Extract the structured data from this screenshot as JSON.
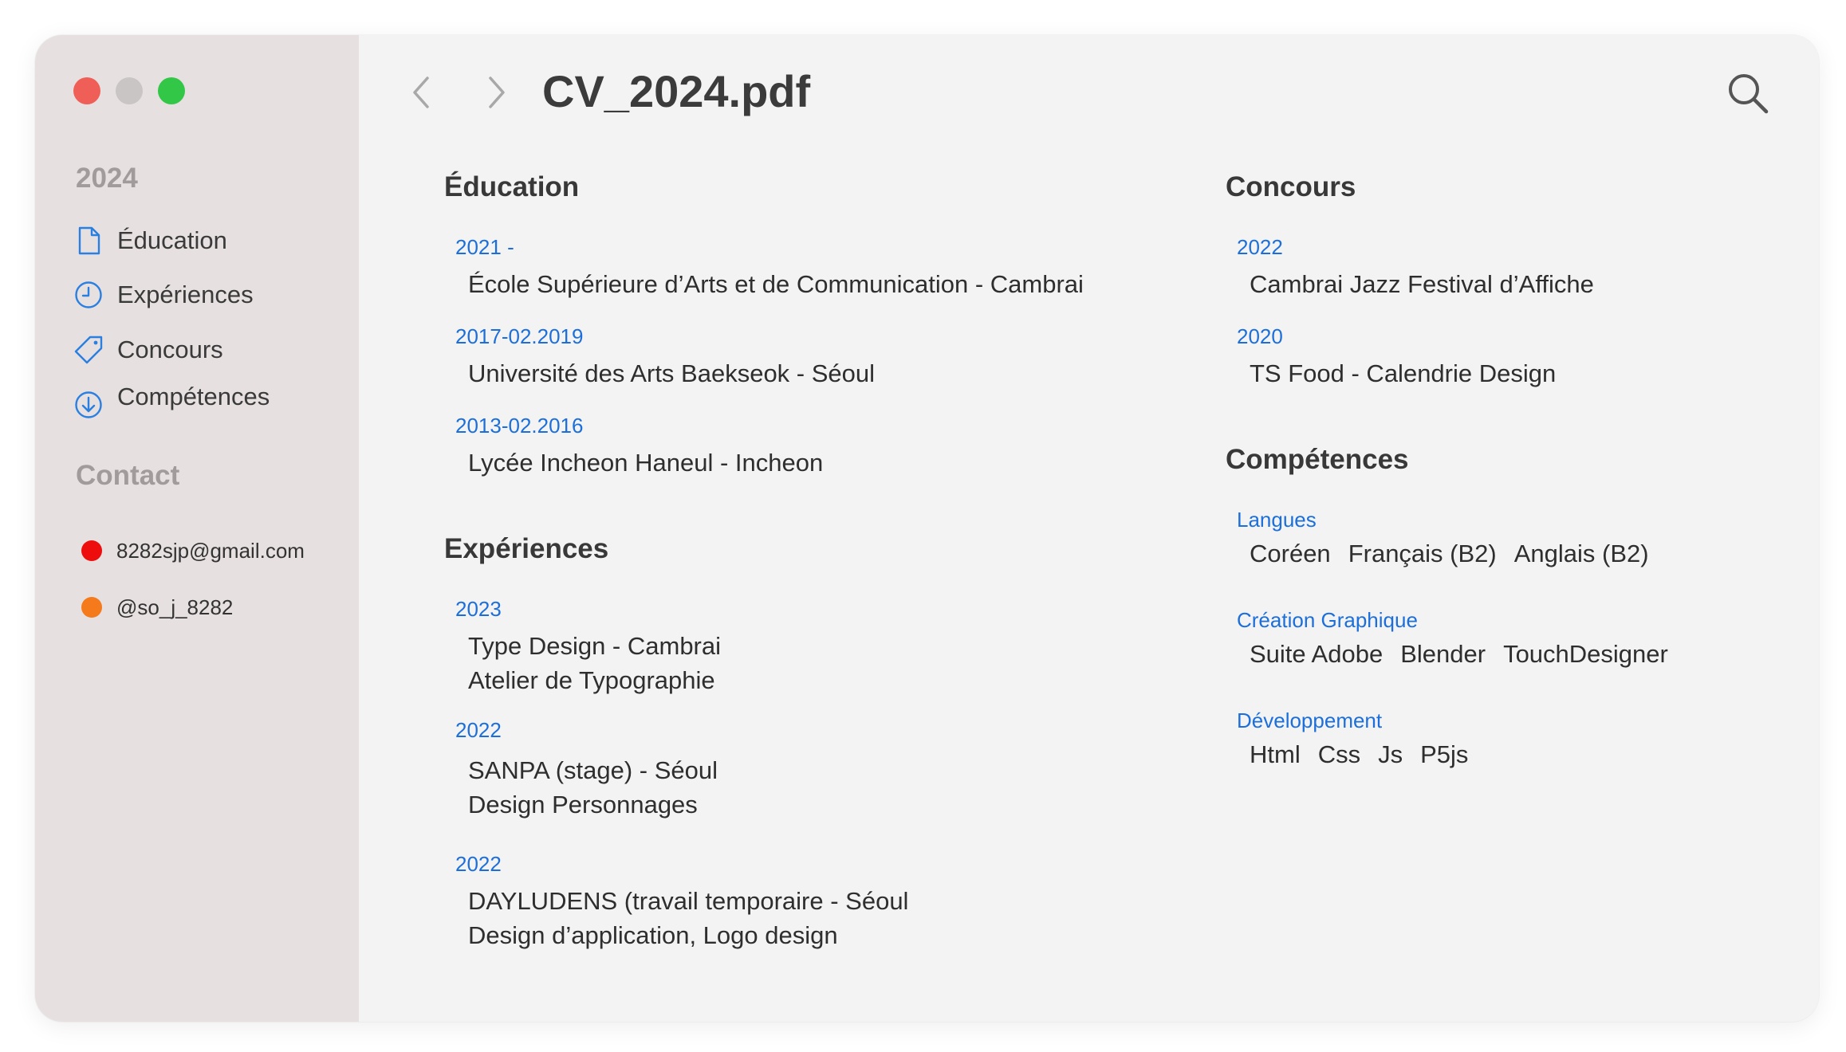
{
  "window": {
    "title": "CV_2024.pdf",
    "traffic_lights": {
      "close": "#ef5f57",
      "minimize": "#c9c5c5",
      "zoom": "#33c748"
    }
  },
  "sidebar": {
    "year_heading": "2024",
    "items": [
      {
        "label": "Éducation",
        "icon": "document-icon"
      },
      {
        "label": "Expériences",
        "icon": "clock-icon"
      },
      {
        "label": "Concours",
        "icon": "tag-icon"
      },
      {
        "label": "Compétences",
        "icon": "download-circle-icon"
      }
    ],
    "contact_heading": "Contact",
    "contacts": [
      {
        "text": "8282sjp@gmail.com",
        "color": "#ee0d0d"
      },
      {
        "text": "@so_j_8282",
        "color": "#f57a1c"
      }
    ]
  },
  "toolbar": {
    "back_icon": "chevron-left-icon",
    "forward_icon": "chevron-right-icon",
    "search_icon": "search-icon"
  },
  "education": {
    "title": "Éducation",
    "entries": [
      {
        "date": "2021 -",
        "text": "École Supérieure d’Arts et de Communication - Cambrai"
      },
      {
        "date": "2017-02.2019",
        "text": "Université des Arts Baekseok - Séoul"
      },
      {
        "date": "2013-02.2016",
        "text": "Lycée Incheon Haneul - Incheon"
      }
    ]
  },
  "experiences": {
    "title": "Expériences",
    "entries": [
      {
        "date": "2023",
        "line1": "Type Design - Cambrai",
        "line2": "Atelier de Typographie"
      },
      {
        "date": "2022",
        "line1": "SANPA (stage) - Séoul",
        "line2": "Design Personnages"
      },
      {
        "date": "2022",
        "line1": "DAYLUDENS (travail temporaire - Séoul",
        "line2": "Design d’application, Logo design"
      }
    ]
  },
  "concours": {
    "title": "Concours",
    "entries": [
      {
        "date": "2022",
        "text": "Cambrai Jazz Festival d’Affiche"
      },
      {
        "date": "2020",
        "text": "TS Food - Calendrie Design"
      }
    ]
  },
  "competences": {
    "title": "Compétences",
    "groups": [
      {
        "label": "Langues",
        "items": [
          "Coréen",
          "Français (B2)",
          "Anglais (B2)"
        ]
      },
      {
        "label": "Création Graphique",
        "items": [
          "Suite Adobe",
          "Blender",
          "TouchDesigner"
        ]
      },
      {
        "label": "Développement",
        "items": [
          "Html",
          "Css",
          "Js",
          "P5js"
        ]
      }
    ]
  },
  "colors": {
    "accent": "#1c6fdb",
    "sidebar_bg": "#e6e0e0",
    "content_bg": "#f3f3f3",
    "sidebar_icon": "#2a7fe0"
  }
}
